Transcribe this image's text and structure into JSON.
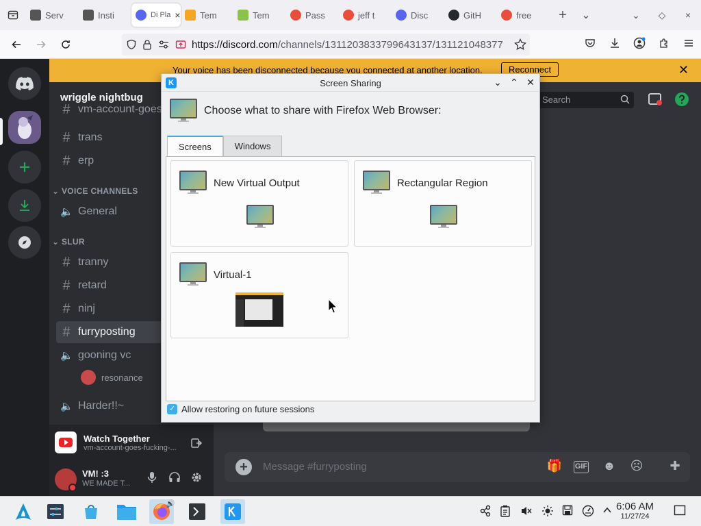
{
  "browser": {
    "tabs": [
      {
        "label": "Serv",
        "color": "#555555"
      },
      {
        "label": "Insti",
        "color": "#555555"
      },
      {
        "label": "Di Pla",
        "color": "#5865f2",
        "active": true
      },
      {
        "label": "Tem",
        "color": "#f5a623"
      },
      {
        "label": "Tem",
        "color": "#8bc34a"
      },
      {
        "label": "Pass",
        "color": "#e94e3d"
      },
      {
        "label": "jeff t",
        "color": "#e94e3d"
      },
      {
        "label": "Disc",
        "color": "#5865f2"
      },
      {
        "label": "GitH",
        "color": "#24292e"
      },
      {
        "label": "free",
        "color": "#e94e3d"
      }
    ],
    "active_tab_close": "×",
    "new_tab": "+",
    "list_tabs": "⌄",
    "win_min": "⌄",
    "win_max": "◇",
    "win_close": "×",
    "url_host": "https://discord.com",
    "url_path": "/channels/1311203833799643137/131121048377"
  },
  "discord": {
    "banner_text": "Your voice has been disconnected because you connected at another location.",
    "reconnect_label": "Reconnect",
    "server_name": "wriggle nightbug",
    "partial_channel": "vm-account-goes-",
    "channels_top": [
      "trans",
      "erp"
    ],
    "voice_category": "VOICE CHANNELS",
    "voice_general": "General",
    "slur_category": "SLUR",
    "slur_channels": [
      "tranny",
      "retard",
      "ninj",
      "furryposting"
    ],
    "gooning_vc": "gooning vc",
    "voice_user": "resonance",
    "harder": "Harder!!~",
    "activity_title": "Watch Together",
    "activity_sub": "vm-account-goes-fucking-...",
    "user_name": "VM! :3",
    "user_status": "WE MADE T...",
    "search_placeholder": "Search",
    "message_placeholder": "Message #furryposting"
  },
  "dialog": {
    "title": "Screen Sharing",
    "heading": "Choose what to share with Firefox Web Browser:",
    "tabs": [
      "Screens",
      "Windows"
    ],
    "options": [
      "New Virtual Output",
      "Rectangular Region",
      "Virtual-1"
    ],
    "restore_label": "Allow restoring on future sessions",
    "restore_checked": true
  },
  "taskbar": {
    "time": "6:06 AM",
    "date": "11/27/24"
  },
  "colors": {
    "accent": "#3daee9",
    "discord_bg": "#313338",
    "banner": "#f0b232"
  }
}
